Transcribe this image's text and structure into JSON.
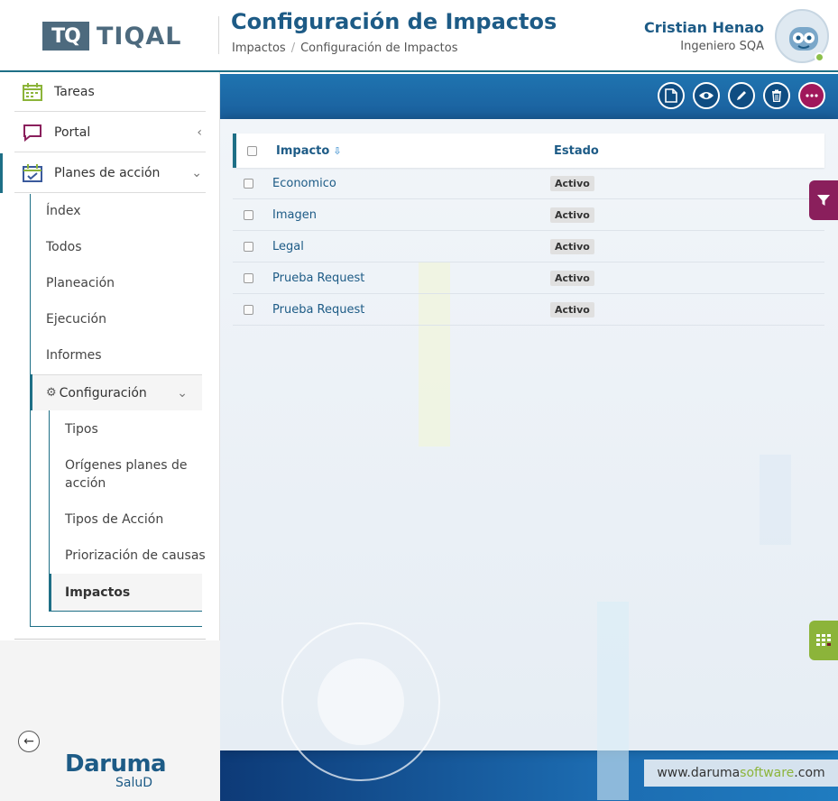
{
  "header": {
    "logo_mark": "TQ",
    "logo_text": "TIQAL",
    "title": "Configuración de Impactos",
    "breadcrumb": [
      "Impactos",
      "Configuración de Impactos"
    ],
    "user_name": "Cristian Henao",
    "user_role": "Ingeniero SQA"
  },
  "sidebar": {
    "items": [
      {
        "label": "Tareas",
        "icon": "calendar-icon"
      },
      {
        "label": "Portal",
        "icon": "chat-icon"
      },
      {
        "label": "Planes de acción",
        "icon": "calendar-check-icon"
      }
    ],
    "plan_sub": [
      "Índex",
      "Todos",
      "Planeación",
      "Ejecución",
      "Informes"
    ],
    "config_label": "Configuración",
    "config_sub": [
      "Tipos",
      "Orígenes planes de acción",
      "Tipos de Acción",
      "Priorización de causas"
    ],
    "active_label": "Impactos",
    "brand": "Daruma",
    "brand_sub": "SaluD"
  },
  "grid": {
    "columns": {
      "impacto": "Impacto",
      "estado": "Estado"
    },
    "rows": [
      {
        "impacto": "Economico",
        "estado": "Activo"
      },
      {
        "impacto": "Imagen",
        "estado": "Activo"
      },
      {
        "impacto": "Legal",
        "estado": "Activo"
      },
      {
        "impacto": "Prueba Request",
        "estado": "Activo"
      },
      {
        "impacto": "Prueba Request",
        "estado": "Activo"
      }
    ]
  },
  "footer": {
    "url_prefix": "www.daruma",
    "url_accent": "software",
    "url_suffix": ".com"
  },
  "colors": {
    "primary": "#1d5b86",
    "accent_teal": "#1e6f86",
    "magenta": "#a0175b",
    "green": "#8cb43a"
  }
}
